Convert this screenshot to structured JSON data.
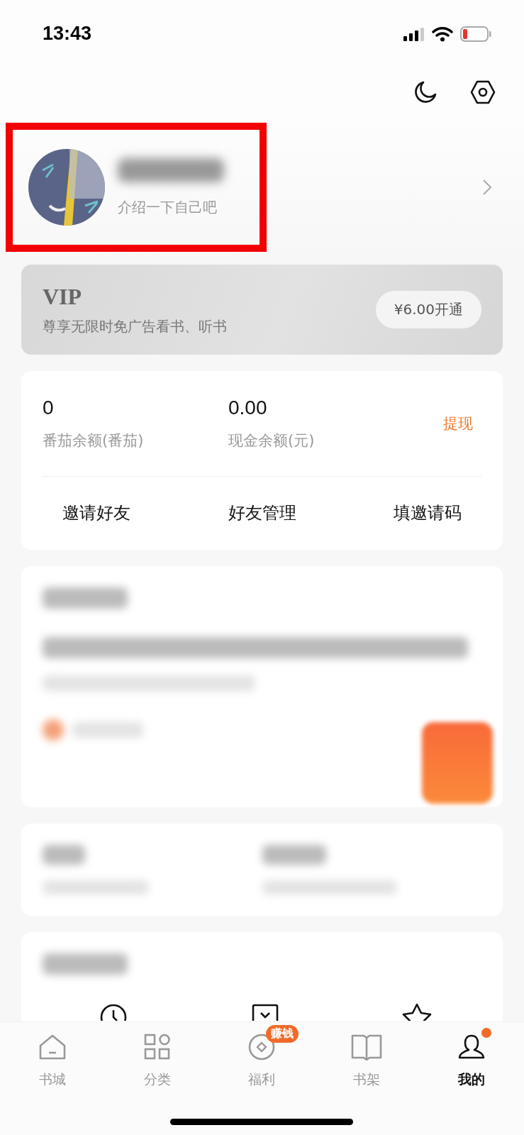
{
  "status_bar": {
    "time": "13:43"
  },
  "profile": {
    "bio": "介绍一下自己吧",
    "highlighted": true
  },
  "vip": {
    "title": "VIP",
    "subtitle": "尊享无限时免广告看书、听书",
    "button": "¥6.00开通"
  },
  "wallet": {
    "balances": [
      {
        "value": "0",
        "label": "番茄余额(番茄)"
      },
      {
        "value": "0.00",
        "label": "现金余额(元)"
      }
    ],
    "withdraw": "提现",
    "actions": [
      "邀请好友",
      "好友管理",
      "填邀请码"
    ]
  },
  "tabs": [
    {
      "kind": "home",
      "label": "书城",
      "selected": false,
      "dot": false
    },
    {
      "kind": "grid",
      "label": "分类",
      "selected": false,
      "dot": false
    },
    {
      "kind": "coin",
      "label": "福利",
      "selected": false,
      "dot": false,
      "badge": "赚钱"
    },
    {
      "kind": "book",
      "label": "书架",
      "selected": false,
      "dot": false
    },
    {
      "kind": "person",
      "label": "我的",
      "selected": true,
      "dot": true
    }
  ]
}
